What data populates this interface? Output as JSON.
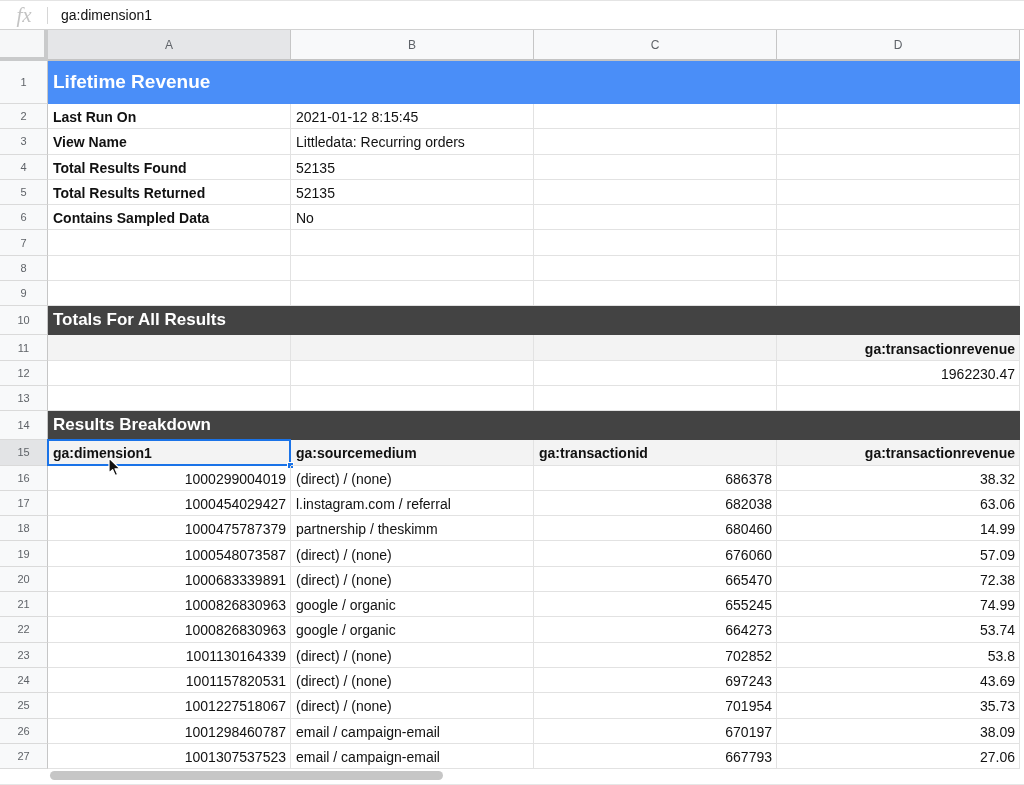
{
  "formula_bar": {
    "icon_label": "fx",
    "value": "ga:dimension1"
  },
  "columns": [
    {
      "label": "A",
      "selected": true
    },
    {
      "label": "B",
      "selected": false
    },
    {
      "label": "C",
      "selected": false
    },
    {
      "label": "D",
      "selected": false
    }
  ],
  "rows": [
    {
      "number": "1",
      "kind": "title",
      "selected": false,
      "cells": [
        {
          "text": "Lifetime Revenue"
        }
      ]
    },
    {
      "number": "2",
      "kind": "info",
      "selected": false,
      "cells": [
        {
          "text": "Last Run On",
          "kind": "text"
        },
        {
          "text": "2021-01-12 8:15:45",
          "kind": "text"
        },
        null,
        null
      ]
    },
    {
      "number": "3",
      "kind": "info",
      "selected": false,
      "cells": [
        {
          "text": "View Name",
          "kind": "text"
        },
        {
          "text": "Littledata: Recurring orders",
          "kind": "text"
        },
        null,
        null
      ]
    },
    {
      "number": "4",
      "kind": "info",
      "selected": false,
      "cells": [
        {
          "text": "Total Results Found",
          "kind": "text"
        },
        {
          "text": "52135",
          "kind": "text"
        },
        null,
        null
      ]
    },
    {
      "number": "5",
      "kind": "info",
      "selected": false,
      "cells": [
        {
          "text": "Total Results Returned",
          "kind": "text"
        },
        {
          "text": "52135",
          "kind": "text"
        },
        null,
        null
      ]
    },
    {
      "number": "6",
      "kind": "info",
      "selected": false,
      "cells": [
        {
          "text": "Contains Sampled Data",
          "kind": "text"
        },
        {
          "text": "No",
          "kind": "text"
        },
        null,
        null
      ]
    },
    {
      "number": "7",
      "kind": "data",
      "selected": false,
      "cells": [
        null,
        null,
        null,
        null
      ]
    },
    {
      "number": "8",
      "kind": "data",
      "selected": false,
      "cells": [
        null,
        null,
        null,
        null
      ]
    },
    {
      "number": "9",
      "kind": "data",
      "selected": false,
      "cells": [
        null,
        null,
        null,
        null
      ]
    },
    {
      "number": "10",
      "kind": "section",
      "selected": false,
      "cells": [
        {
          "text": "Totals For All Results"
        }
      ]
    },
    {
      "number": "11",
      "kind": "header",
      "selected": false,
      "cells": [
        null,
        null,
        null,
        {
          "text": "ga:transactionrevenue",
          "kind": "number"
        }
      ]
    },
    {
      "number": "12",
      "kind": "data",
      "selected": false,
      "cells": [
        null,
        null,
        null,
        {
          "text": "1962230.47",
          "kind": "number"
        }
      ]
    },
    {
      "number": "13",
      "kind": "data",
      "selected": false,
      "cells": [
        null,
        null,
        null,
        null
      ]
    },
    {
      "number": "14",
      "kind": "section",
      "selected": false,
      "cells": [
        {
          "text": "Results Breakdown"
        }
      ]
    },
    {
      "number": "15",
      "kind": "header",
      "selected": true,
      "cells": [
        {
          "text": "ga:dimension1",
          "kind": "text"
        },
        {
          "text": "ga:sourcemedium",
          "kind": "text"
        },
        {
          "text": "ga:transactionid",
          "kind": "text"
        },
        {
          "text": "ga:transactionrevenue",
          "kind": "number"
        }
      ]
    },
    {
      "number": "16",
      "kind": "data",
      "selected": false,
      "cells": [
        {
          "text": "1000299004019",
          "kind": "number"
        },
        {
          "text": "(direct) / (none)",
          "kind": "text"
        },
        {
          "text": "686378",
          "kind": "number"
        },
        {
          "text": "38.32",
          "kind": "number"
        }
      ]
    },
    {
      "number": "17",
      "kind": "data",
      "selected": false,
      "cells": [
        {
          "text": "1000454029427",
          "kind": "number"
        },
        {
          "text": "l.instagram.com / referral",
          "kind": "text"
        },
        {
          "text": "682038",
          "kind": "number"
        },
        {
          "text": "63.06",
          "kind": "number"
        }
      ]
    },
    {
      "number": "18",
      "kind": "data",
      "selected": false,
      "cells": [
        {
          "text": "1000475787379",
          "kind": "number"
        },
        {
          "text": "partnership / theskimm",
          "kind": "text"
        },
        {
          "text": "680460",
          "kind": "number"
        },
        {
          "text": "14.99",
          "kind": "number"
        }
      ]
    },
    {
      "number": "19",
      "kind": "data",
      "selected": false,
      "cells": [
        {
          "text": "1000548073587",
          "kind": "number"
        },
        {
          "text": "(direct) / (none)",
          "kind": "text"
        },
        {
          "text": "676060",
          "kind": "number"
        },
        {
          "text": "57.09",
          "kind": "number"
        }
      ]
    },
    {
      "number": "20",
      "kind": "data",
      "selected": false,
      "cells": [
        {
          "text": "1000683339891",
          "kind": "number"
        },
        {
          "text": "(direct) / (none)",
          "kind": "text"
        },
        {
          "text": "665470",
          "kind": "number"
        },
        {
          "text": "72.38",
          "kind": "number"
        }
      ]
    },
    {
      "number": "21",
      "kind": "data",
      "selected": false,
      "cells": [
        {
          "text": "1000826830963",
          "kind": "number"
        },
        {
          "text": "google / organic",
          "kind": "text"
        },
        {
          "text": "655245",
          "kind": "number"
        },
        {
          "text": "74.99",
          "kind": "number"
        }
      ]
    },
    {
      "number": "22",
      "kind": "data",
      "selected": false,
      "cells": [
        {
          "text": "1000826830963",
          "kind": "number"
        },
        {
          "text": "google / organic",
          "kind": "text"
        },
        {
          "text": "664273",
          "kind": "number"
        },
        {
          "text": "53.74",
          "kind": "number"
        }
      ]
    },
    {
      "number": "23",
      "kind": "data",
      "selected": false,
      "cells": [
        {
          "text": "1001130164339",
          "kind": "number"
        },
        {
          "text": "(direct) / (none)",
          "kind": "text"
        },
        {
          "text": "702852",
          "kind": "number"
        },
        {
          "text": "53.8",
          "kind": "number"
        }
      ]
    },
    {
      "number": "24",
      "kind": "data",
      "selected": false,
      "cells": [
        {
          "text": "1001157820531",
          "kind": "number"
        },
        {
          "text": "(direct) / (none)",
          "kind": "text"
        },
        {
          "text": "697243",
          "kind": "number"
        },
        {
          "text": "43.69",
          "kind": "number"
        }
      ]
    },
    {
      "number": "25",
      "kind": "data",
      "selected": false,
      "cells": [
        {
          "text": "1001227518067",
          "kind": "number"
        },
        {
          "text": "(direct) / (none)",
          "kind": "text"
        },
        {
          "text": "701954",
          "kind": "number"
        },
        {
          "text": "35.73",
          "kind": "number"
        }
      ]
    },
    {
      "number": "26",
      "kind": "data",
      "selected": false,
      "cells": [
        {
          "text": "1001298460787",
          "kind": "number"
        },
        {
          "text": "email / campaign-email",
          "kind": "text"
        },
        {
          "text": "670197",
          "kind": "number"
        },
        {
          "text": "38.09",
          "kind": "number"
        }
      ]
    },
    {
      "number": "27",
      "kind": "data",
      "selected": false,
      "cells": [
        {
          "text": "1001307537523",
          "kind": "number"
        },
        {
          "text": "email / campaign-email",
          "kind": "text"
        },
        {
          "text": "667793",
          "kind": "number"
        },
        {
          "text": "27.06",
          "kind": "number"
        }
      ]
    }
  ]
}
